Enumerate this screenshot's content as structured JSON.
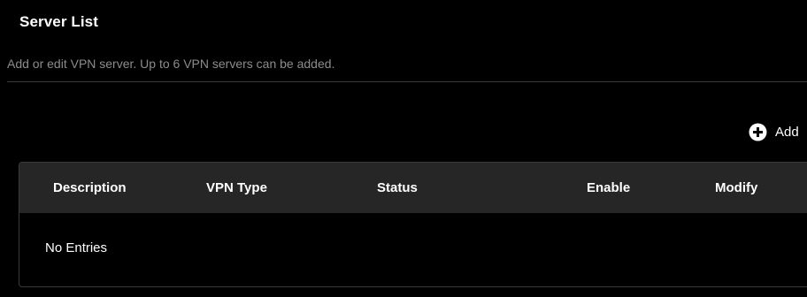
{
  "section": {
    "title": "Server List",
    "description": "Add or edit VPN server. Up to 6 VPN servers can be added."
  },
  "toolbar": {
    "add_label": "Add",
    "add_icon": "plus-circle-icon"
  },
  "table": {
    "columns": [
      "Description",
      "VPN Type",
      "Status",
      "Enable",
      "Modify"
    ],
    "rows": [],
    "empty_text": "No Entries"
  },
  "colors": {
    "background": "#000000",
    "header_background": "#262626",
    "border": "#3a3a3a",
    "muted_text": "#8c8c8c",
    "text": "#ffffff"
  }
}
